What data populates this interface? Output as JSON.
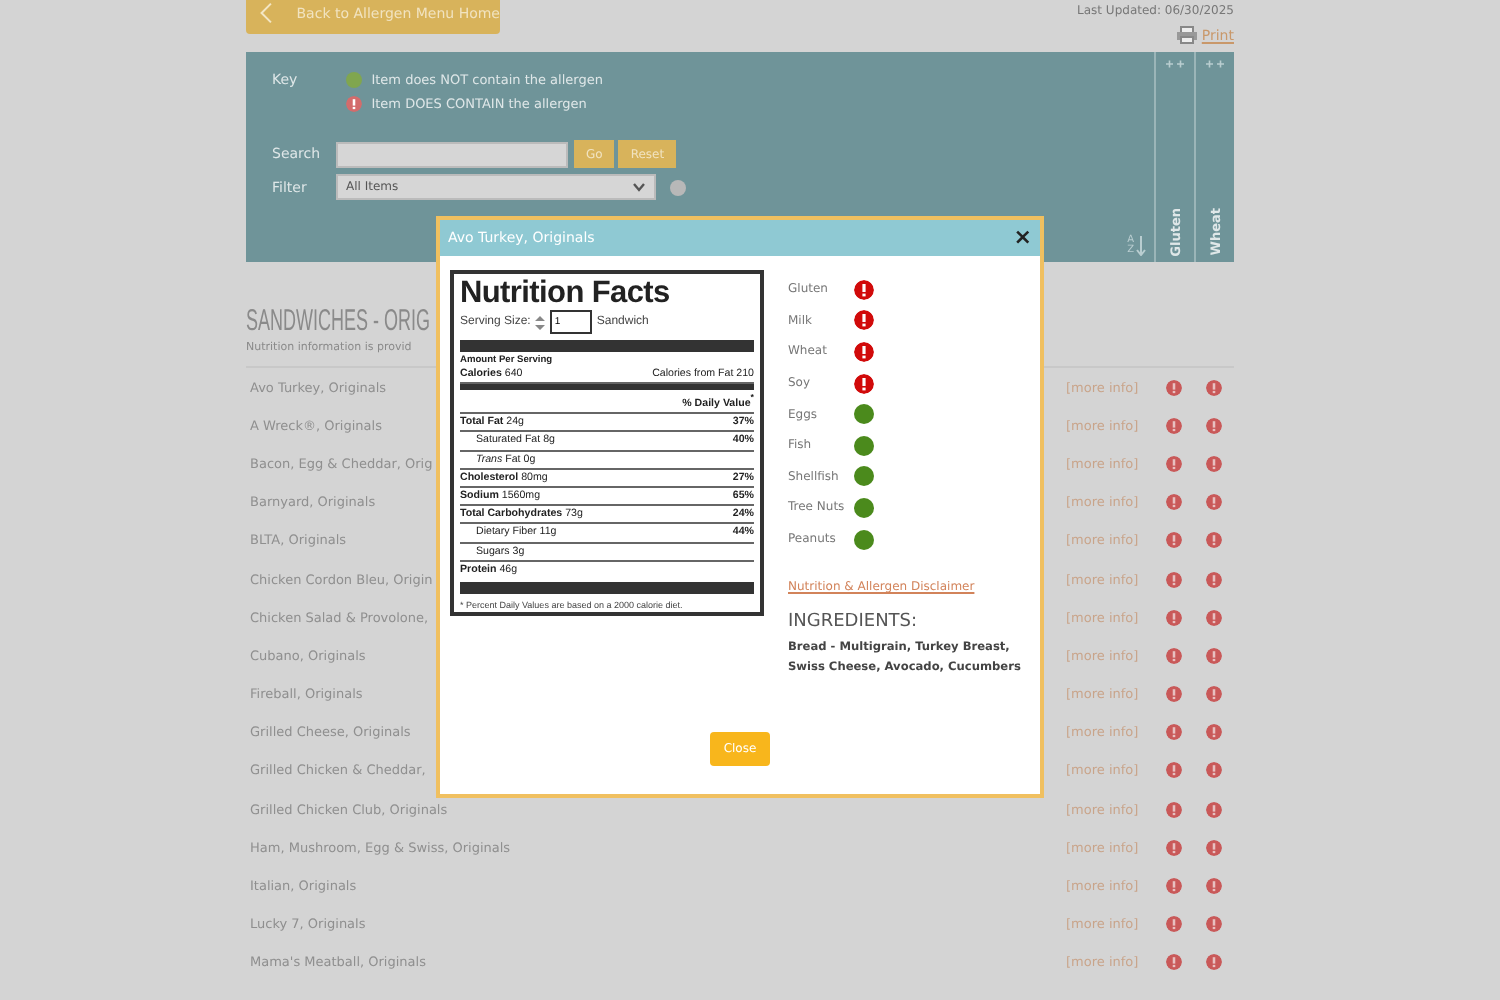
{
  "back_button": "Back to Allergen Menu Home",
  "last_updated": "Last Updated: 06/30/2025",
  "print_link": "Print",
  "key": {
    "label": "Key",
    "items": [
      {
        "contains": false,
        "text": "Item does NOT contain the allergen"
      },
      {
        "contains": true,
        "text": "Item DOES CONTAIN the allergen"
      }
    ]
  },
  "search": {
    "label": "Search",
    "go": "Go",
    "reset": "Reset"
  },
  "filter": {
    "label": "Filter",
    "value": "All Items"
  },
  "sort": {
    "letters": [
      "A",
      "Z"
    ]
  },
  "columns": [
    {
      "name": "Gluten"
    },
    {
      "name": "Wheat"
    }
  ],
  "section": {
    "title": "SANDWICHES - ORIG",
    "note": "Nutrition information is provid"
  },
  "rows": [
    {
      "name": "Avo Turkey, Originals",
      "more": "[more info]",
      "gluten": true,
      "wheat": true
    },
    {
      "name": "A Wreck®, Originals",
      "more": "[more info]",
      "gluten": true,
      "wheat": true
    },
    {
      "name": "Bacon, Egg & Cheddar, Orig",
      "more": "[more info]",
      "gluten": true,
      "wheat": true
    },
    {
      "name": "Barnyard, Originals",
      "more": "[more info]",
      "gluten": true,
      "wheat": true
    },
    {
      "name": "BLTA, Originals",
      "more": "[more info]",
      "gluten": true,
      "wheat": true
    },
    {
      "name": "Chicken Cordon Bleu, Origin",
      "more": "[more info]",
      "gluten": true,
      "wheat": true
    },
    {
      "name": "Chicken Salad & Provolone,",
      "more": "[more info]",
      "gluten": true,
      "wheat": true
    },
    {
      "name": "Cubano, Originals",
      "more": "[more info]",
      "gluten": true,
      "wheat": true
    },
    {
      "name": "Fireball, Originals",
      "more": "[more info]",
      "gluten": true,
      "wheat": true
    },
    {
      "name": "Grilled Cheese, Originals",
      "more": "[more info]",
      "gluten": true,
      "wheat": true
    },
    {
      "name": "Grilled Chicken & Cheddar,",
      "more": "[more info]",
      "gluten": true,
      "wheat": true
    },
    {
      "name": "Grilled Chicken Club, Originals",
      "more": "[more info]",
      "gluten": true,
      "wheat": true
    },
    {
      "name": "Ham, Mushroom, Egg & Swiss, Originals",
      "more": "[more info]",
      "gluten": true,
      "wheat": true
    },
    {
      "name": "Italian, Originals",
      "more": "[more info]",
      "gluten": true,
      "wheat": true
    },
    {
      "name": "Lucky 7, Originals",
      "more": "[more info]",
      "gluten": true,
      "wheat": true
    },
    {
      "name": "Mama's Meatball, Originals",
      "more": "[more info]",
      "gluten": true,
      "wheat": true
    }
  ],
  "modal": {
    "title": "Avo Turkey, Originals",
    "close_x": "×",
    "facts": {
      "title": "Nutrition Facts",
      "serving_label": "Serving Size:",
      "serving_value": "1",
      "serving_unit": "Sandwich",
      "amount": "Amount Per Serving",
      "calories": "**Calories** 640",
      "calories_fat": "Calories from Fat 210",
      "dv_header": "% Daily Value$^{*}$",
      "lines": [
        {
          "kind": "main",
          "text": "**Total Fat** 24g",
          "dv": "37%"
        },
        {
          "kind": "sub",
          "text": "Saturated Fat 8g",
          "dv": "40%"
        },
        {
          "kind": "sub",
          "text": "*Trans* Fat 0g"
        },
        {
          "kind": "main",
          "text": "**Cholesterol** 80mg",
          "dv": "27%"
        },
        {
          "kind": "main",
          "text": "**Sodium** 1560mg",
          "dv": "65%"
        },
        {
          "kind": "main",
          "text": "**Total Carbohydrates** 73g",
          "dv": "24%"
        },
        {
          "kind": "sub",
          "text": "Dietary Fiber 11g",
          "dv": "44%"
        },
        {
          "kind": "sub",
          "text": "Sugars 3g"
        },
        {
          "kind": "protein",
          "text": "**Protein** 46g"
        }
      ],
      "footnote": "* Percent Daily Values are based on a 2000 calorie diet."
    },
    "allergens": [
      {
        "name": "Gluten",
        "contains": true
      },
      {
        "name": "Milk",
        "contains": true
      },
      {
        "name": "Wheat",
        "contains": true
      },
      {
        "name": "Soy",
        "contains": true
      },
      {
        "name": "Eggs",
        "contains": false
      },
      {
        "name": "Fish",
        "contains": false
      },
      {
        "name": "Shellfish",
        "contains": false
      },
      {
        "name": "Tree Nuts",
        "contains": false
      },
      {
        "name": "Peanuts",
        "contains": false
      }
    ],
    "disclaimer": "Nutrition & Allergen Disclaimer",
    "ingredients_title": "INGREDIENTS:",
    "ingredients": "Bread - Multigrain, Turkey Breast, Swiss Cheese, Avocado, Cucumbers",
    "close": "Close"
  }
}
